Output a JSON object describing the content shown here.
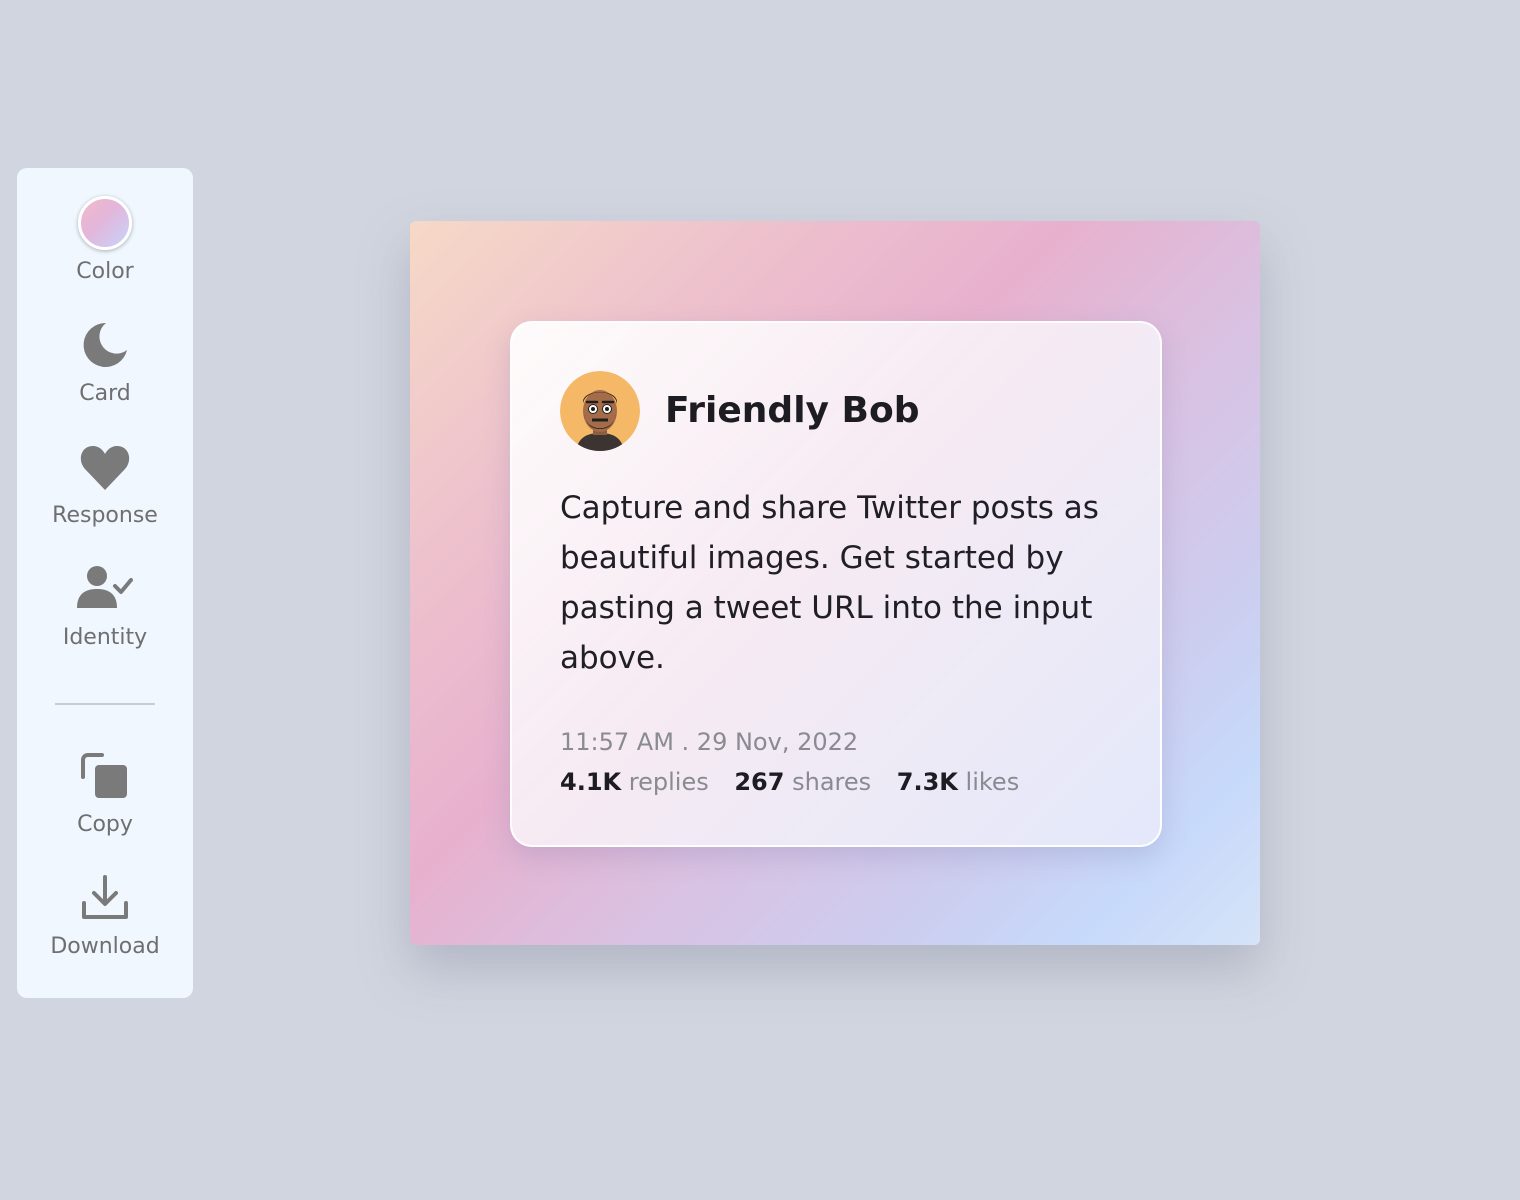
{
  "toolbar": {
    "items": [
      {
        "label": "Color",
        "icon": "color-swatch"
      },
      {
        "label": "Card",
        "icon": "moon-icon"
      },
      {
        "label": "Response",
        "icon": "heart-icon"
      },
      {
        "label": "Identity",
        "icon": "user-check-icon"
      },
      {
        "label": "Copy",
        "icon": "copy-icon"
      },
      {
        "label": "Download",
        "icon": "download-icon"
      }
    ]
  },
  "tweet": {
    "author": "Friendly Bob",
    "text": "Capture and share Twitter posts as beautiful images. Get started by pasting a tweet URL into the input above.",
    "timestamp": "11:57 AM . 29 Nov, 2022",
    "stats": {
      "replies_count": "4.1K",
      "replies_label": "replies",
      "shares_count": "267",
      "shares_label": "shares",
      "likes_count": "7.3K",
      "likes_label": "likes"
    }
  },
  "colors": {
    "page_background": "#d1d5df",
    "toolbar_background": "#f0f7ff",
    "icon_gray": "#7a7a7a",
    "avatar_background": "#f4b867"
  }
}
